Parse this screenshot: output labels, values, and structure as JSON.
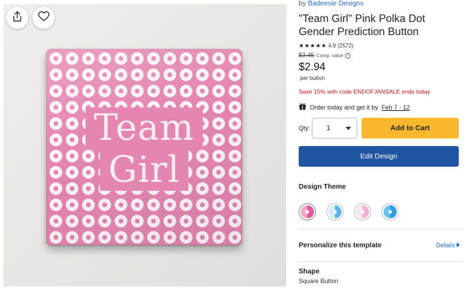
{
  "byline": {
    "prefix": "by",
    "shop": "Badeesie Designs"
  },
  "title": "\"Team Girl\" Pink Polka Dot Gender Prediction Button",
  "rating": {
    "stars": "★★★★★",
    "score": "4.9",
    "count": "(2572)"
  },
  "price": {
    "compare_value": "$3.45",
    "compare_label": "Comp. value",
    "current": "$2.94",
    "unit": "per button"
  },
  "promo": "Save 15% with code ENDOFJANSALE ends today",
  "delivery": {
    "text": "Order today and get it by",
    "dates": "Feb 7 - 12"
  },
  "quantity": {
    "label": "Qty:",
    "value": "1"
  },
  "buttons": {
    "add_to_cart": "Add to Cart",
    "edit_design": "Edit Design"
  },
  "design_theme": {
    "title": "Design Theme",
    "options": [
      {
        "colors": [
          "#f3a8c9",
          "#e3569a"
        ],
        "selected": true
      },
      {
        "colors": [
          "#d7eef9",
          "#5bb8e8"
        ],
        "selected": false
      },
      {
        "colors": [
          "#fbe3ee",
          "#f3b2cf"
        ],
        "selected": false
      },
      {
        "colors": [
          "#62c3f3",
          "#2b9ee2"
        ],
        "selected": false
      }
    ]
  },
  "personalize": {
    "title": "Personalize this template",
    "link": "Details"
  },
  "shape": {
    "title": "Shape",
    "value": "Square Button"
  },
  "product_image": {
    "badge_text": [
      "Team",
      "Girl"
    ],
    "badge_color": "#e486b0",
    "dot_color": "#fbf4f8",
    "icons": [
      "share-icon",
      "heart-icon"
    ]
  },
  "colors": {
    "link": "#1f6ad4",
    "add_to_cart": "#f8b72c",
    "edit_design": "#1f55a3",
    "promo": "#d20f0f"
  }
}
